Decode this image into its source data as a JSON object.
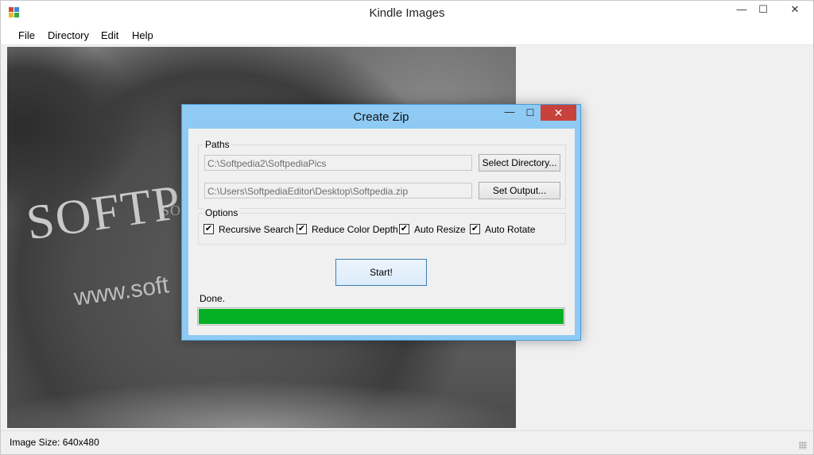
{
  "window": {
    "title": "Kindle Images",
    "buttons": {
      "minimize": "—",
      "maximize": "☐",
      "close": "✕"
    }
  },
  "menu": {
    "items": [
      {
        "label": "File"
      },
      {
        "label": "Directory"
      },
      {
        "label": "Edit"
      },
      {
        "label": "Help"
      }
    ]
  },
  "image": {
    "text_large": "SOFTP",
    "text_url": "www.soft",
    "watermark": "SOFTPEDIA"
  },
  "status": {
    "text": "Image Size: 640x480"
  },
  "dialog": {
    "title": "Create Zip",
    "buttons": {
      "minimize": "—",
      "maximize": "☐",
      "close": "✕"
    },
    "paths": {
      "legend": "Paths",
      "directory_value": "C:\\Softpedia2\\SoftpediaPics",
      "select_directory_label": "Select Directory...",
      "output_value": "C:\\Users\\SoftpediaEditor\\Desktop\\Softpedia.zip",
      "set_output_label": "Set Output..."
    },
    "options": {
      "legend": "Options",
      "items": [
        {
          "label": "Recursive Search",
          "checked": true,
          "mark": "✔"
        },
        {
          "label": "Reduce Color Depth",
          "checked": true,
          "mark": "✔"
        },
        {
          "label": "Auto Resize",
          "checked": true,
          "mark": "✔"
        },
        {
          "label": "Auto Rotate",
          "checked": true,
          "mark": "✔"
        }
      ]
    },
    "start_label": "Start!",
    "status_text": "Done.",
    "progress": 1.0,
    "progress_color": "#06b025"
  }
}
